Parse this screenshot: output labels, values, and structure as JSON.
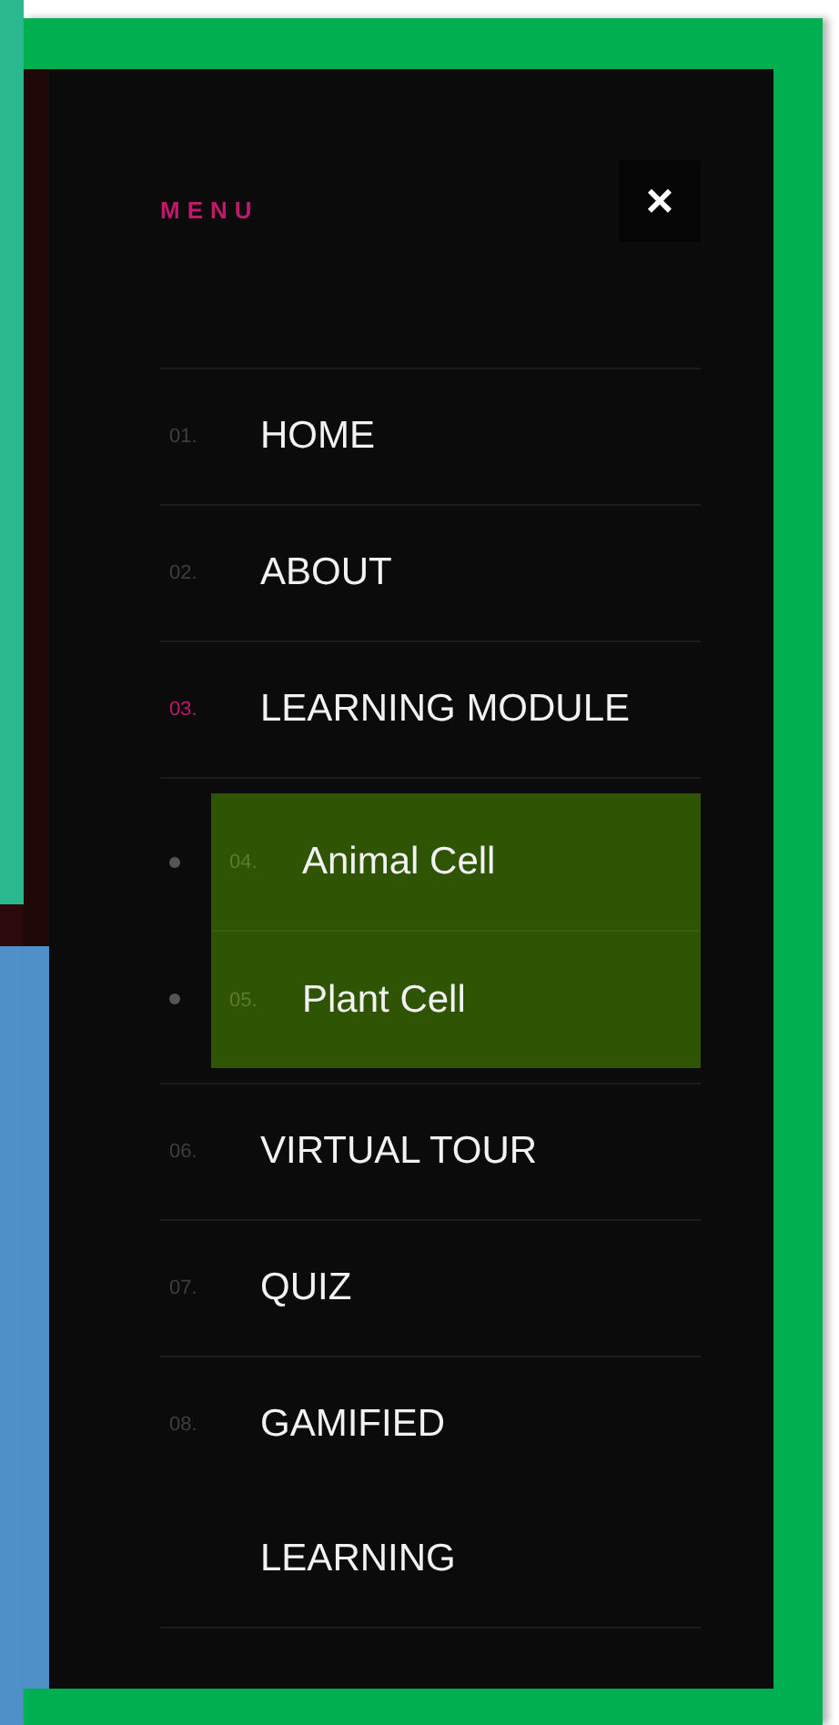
{
  "menu": {
    "title": "MENU",
    "close": "×",
    "items": [
      {
        "number": "01.",
        "lines": [
          "HOME"
        ],
        "selected": false
      },
      {
        "number": "02.",
        "lines": [
          "ABOUT"
        ],
        "selected": false
      },
      {
        "number": "03.",
        "lines": [
          "LEARNING MODULE"
        ],
        "selected": true,
        "expanded": true,
        "children": [
          {
            "number": "04.",
            "lines": [
              "Animal Cell"
            ],
            "selected": false
          },
          {
            "number": "05.",
            "lines": [
              "Plant Cell"
            ],
            "selected": false
          }
        ]
      },
      {
        "number": "06.",
        "lines": [
          "VIRTUAL TOUR"
        ],
        "selected": false
      },
      {
        "number": "07.",
        "lines": [
          "QUIZ"
        ],
        "selected": false
      },
      {
        "number": "08.",
        "lines": [
          "GAMIFIED",
          "LEARNING"
        ],
        "selected": false
      }
    ]
  }
}
